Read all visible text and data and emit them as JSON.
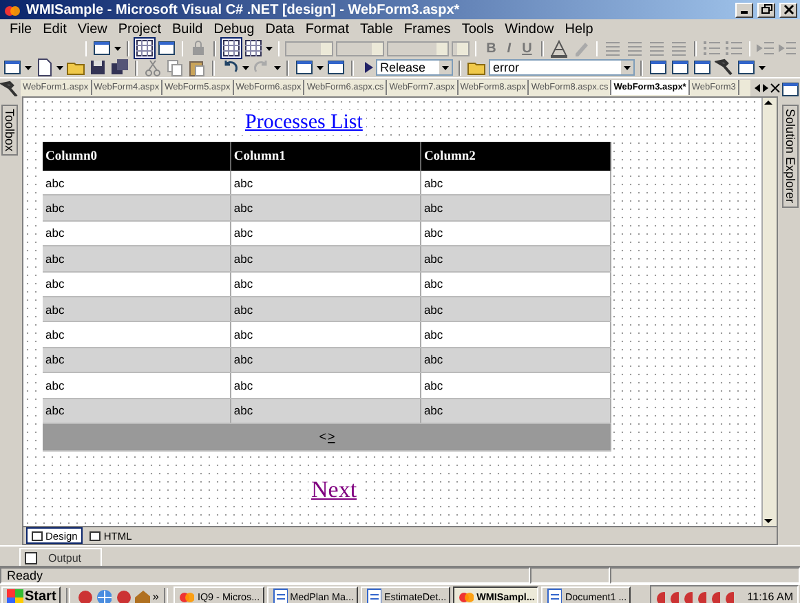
{
  "window": {
    "title": "WMISample - Microsoft Visual C# .NET [design] - WebForm3.aspx*"
  },
  "menu": [
    "File",
    "Edit",
    "View",
    "Project",
    "Build",
    "Debug",
    "Data",
    "Format",
    "Table",
    "Frames",
    "Tools",
    "Window",
    "Help"
  ],
  "format_toolbar": {
    "text_buttons": [
      "B",
      "I",
      "U"
    ]
  },
  "standard_toolbar": {
    "configuration": "Release",
    "find": "error"
  },
  "document_tabs": [
    {
      "label": "WebForm1.aspx",
      "selected": false
    },
    {
      "label": "WebForm4.aspx",
      "selected": false
    },
    {
      "label": "WebForm5.aspx",
      "selected": false
    },
    {
      "label": "WebForm6.aspx",
      "selected": false
    },
    {
      "label": "WebForm6.aspx.cs",
      "selected": false
    },
    {
      "label": "WebForm7.aspx",
      "selected": false
    },
    {
      "label": "WebForm8.aspx",
      "selected": false
    },
    {
      "label": "WebForm8.aspx.cs",
      "selected": false
    },
    {
      "label": "WebForm3.aspx*",
      "selected": true
    },
    {
      "label": "WebForm3",
      "selected": false
    }
  ],
  "side_panels": {
    "left": "Toolbox",
    "right": "Solution Explorer"
  },
  "page": {
    "heading": "Processes List",
    "grid": {
      "columns": [
        "Column0",
        "Column1",
        "Column2"
      ],
      "rows": [
        [
          "abc",
          "abc",
          "abc"
        ],
        [
          "abc",
          "abc",
          "abc"
        ],
        [
          "abc",
          "abc",
          "abc"
        ],
        [
          "abc",
          "abc",
          "abc"
        ],
        [
          "abc",
          "abc",
          "abc"
        ],
        [
          "abc",
          "abc",
          "abc"
        ],
        [
          "abc",
          "abc",
          "abc"
        ],
        [
          "abc",
          "abc",
          "abc"
        ],
        [
          "abc",
          "abc",
          "abc"
        ],
        [
          "abc",
          "abc",
          "abc"
        ]
      ],
      "pager": {
        "previous": "<",
        "next": ">"
      }
    },
    "link": "Next"
  },
  "view_tabs": [
    {
      "label": "Design",
      "selected": true
    },
    {
      "label": "HTML",
      "selected": false
    }
  ],
  "output_tab": "Output",
  "status_bar": {
    "text": "Ready"
  },
  "taskbar": {
    "start": "Start",
    "overflow": "»",
    "buttons": [
      {
        "label": "IQ9 - Micros...",
        "selected": false
      },
      {
        "label": "MedPlan Ma...",
        "selected": false
      },
      {
        "label": "EstimateDet...",
        "selected": false
      },
      {
        "label": "WMISampl...",
        "selected": true
      },
      {
        "label": "Document1 ...",
        "selected": false
      }
    ],
    "clock": "11:16 AM"
  }
}
